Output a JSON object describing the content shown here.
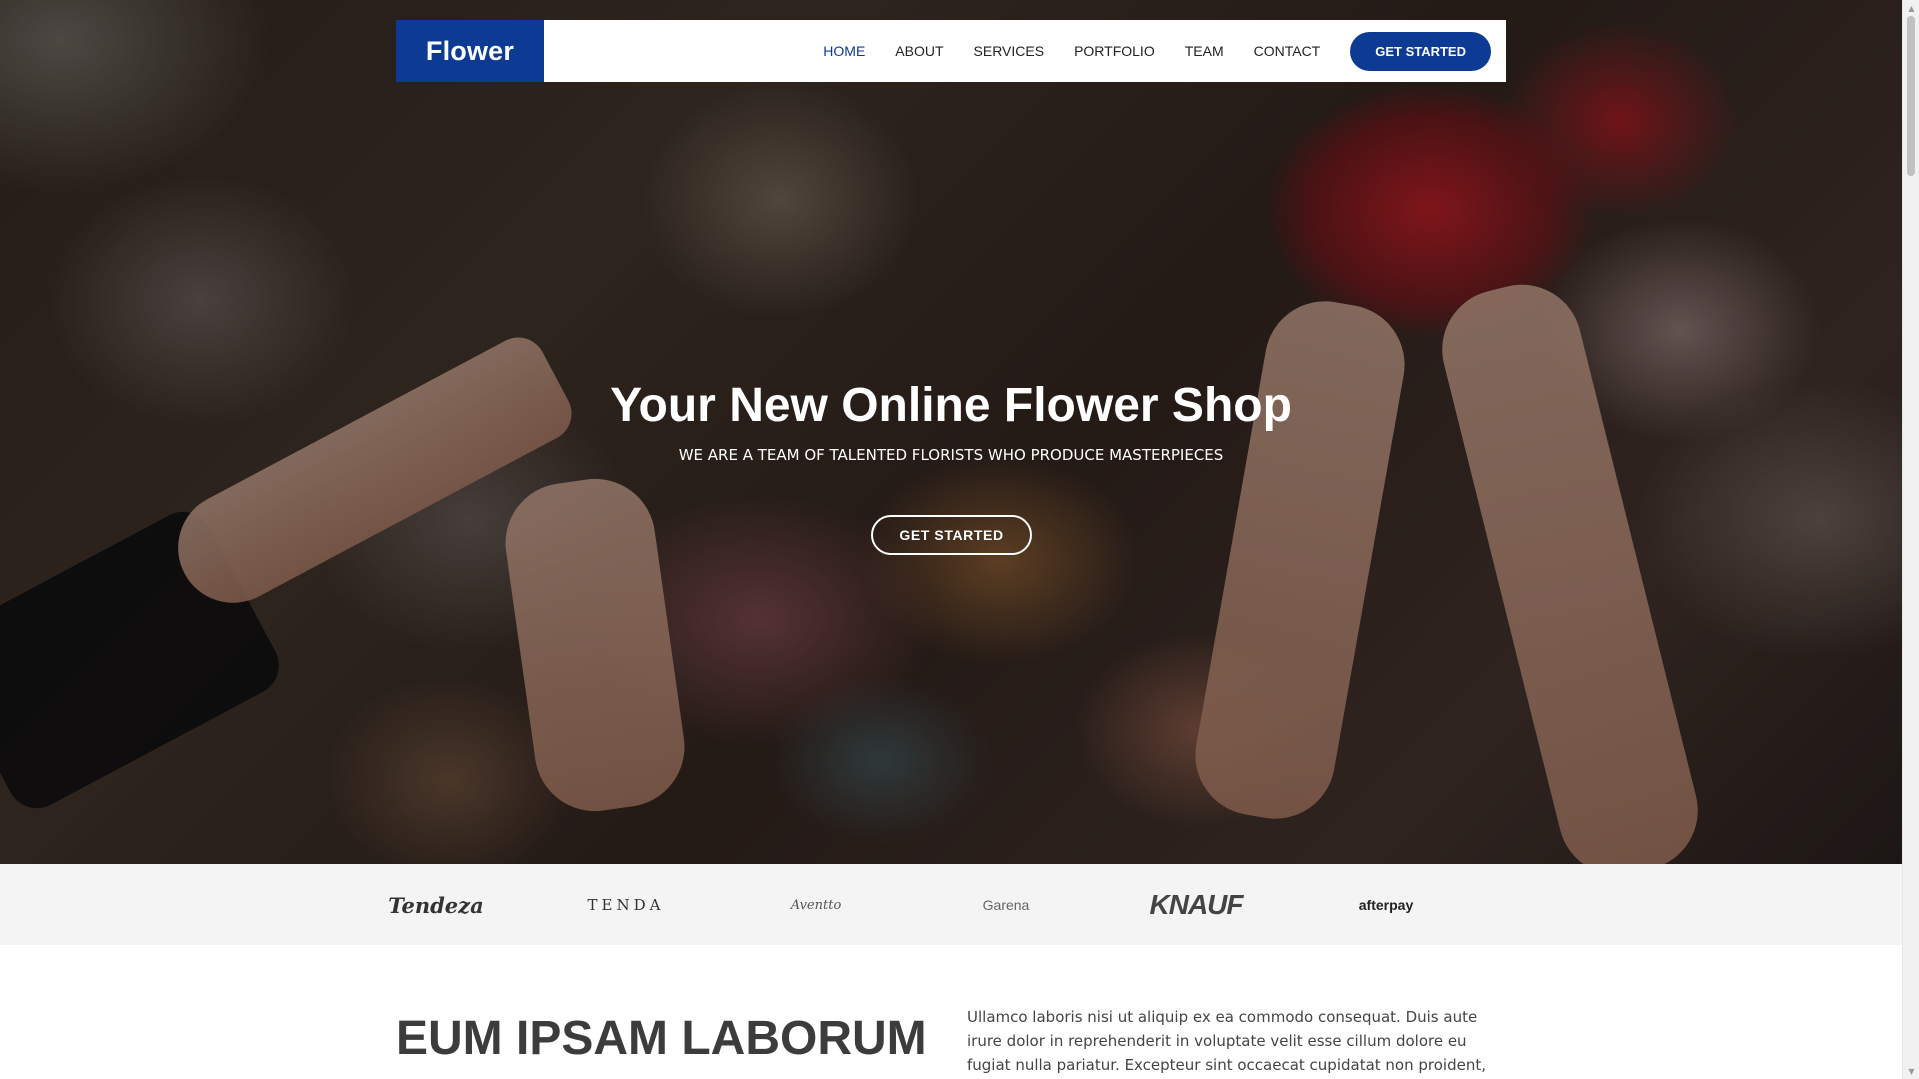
{
  "brand": {
    "logo_text": "Flower",
    "color": "#0d3b93"
  },
  "nav": {
    "items": [
      {
        "label": "HOME",
        "active": true
      },
      {
        "label": "ABOUT"
      },
      {
        "label": "SERVICES"
      },
      {
        "label": "PORTFOLIO"
      },
      {
        "label": "TEAM"
      },
      {
        "label": "CONTACT"
      }
    ],
    "cta_label": "GET STARTED"
  },
  "hero": {
    "title": "Your New Online Flower Shop",
    "subtitle": "WE ARE A TEAM OF TALENTED FLORISTS WHO PRODUCE MASTERPIECES",
    "button_label": "GET STARTED"
  },
  "clients": [
    "Tendeza",
    "TENDA",
    "Aventto",
    "Garena",
    "KNAUF",
    "afterpay"
  ],
  "about": {
    "title": "EUM IPSAM LABORUM DELENITI VELITENA",
    "text": "Ullamco laboris nisi ut aliquip ex ea commodo consequat. Duis aute irure dolor in reprehenderit in voluptate velit esse cillum dolore eu fugiat nulla pariatur. Excepteur sint occaecat cupidatat non proident,"
  }
}
